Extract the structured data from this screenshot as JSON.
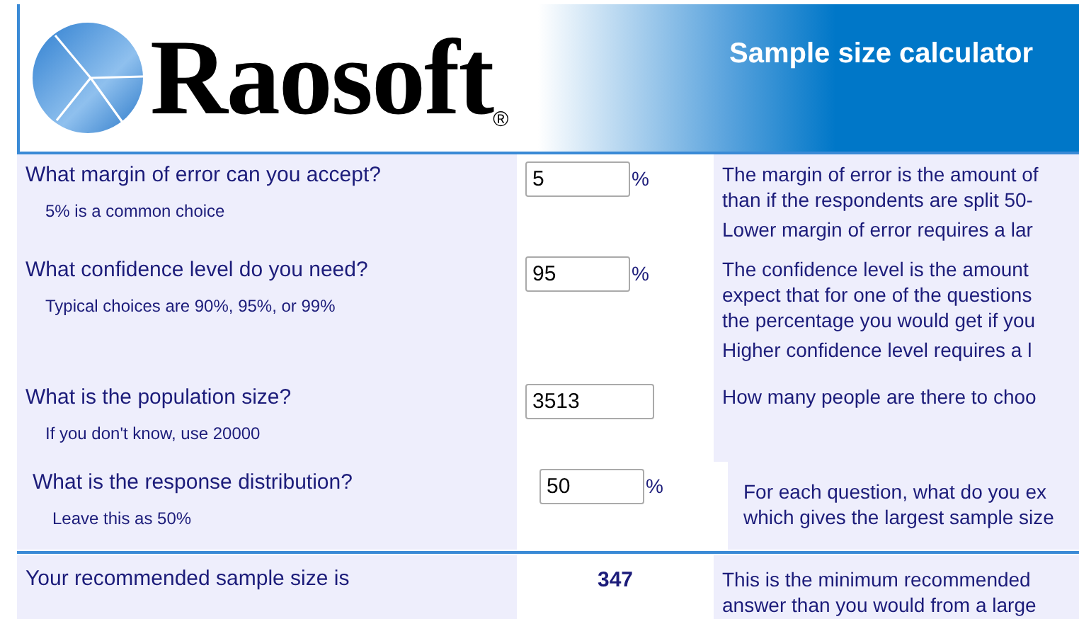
{
  "header": {
    "logo": "Raosoft",
    "registered_mark": "®",
    "title": "Sample size calculator"
  },
  "questions": [
    {
      "question": "What margin of error can you accept?",
      "hint": "5% is a common choice",
      "value": "5",
      "unit": "%",
      "explanation": [
        [
          "The margin of error is the amount of",
          "than if the respondents are split 50-"
        ],
        [
          "Lower margin of error requires a lar"
        ]
      ]
    },
    {
      "question": "What confidence level do you need?",
      "hint": "Typical choices are 90%, 95%, or 99%",
      "value": "95",
      "unit": "%",
      "explanation": [
        [
          "The confidence level is the amount",
          "expect that for one of the questions",
          "the percentage you would get if you"
        ],
        [
          "Higher confidence level requires a l"
        ]
      ]
    },
    {
      "question": "What is the population size?",
      "hint": "If you don't know, use 20000",
      "value": "3513",
      "explanation": [
        [
          "How many people are there to choo"
        ]
      ]
    },
    {
      "question": "What is the response distribution?",
      "hint": "Leave this as 50%",
      "value": "50",
      "unit": "%",
      "explanation": [
        [
          "For each question, what do you ex",
          "which gives the largest sample size"
        ]
      ]
    }
  ],
  "result": {
    "label": "Your recommended sample size is",
    "value": "347",
    "explanation": [
      [
        "This is the minimum recommended",
        "answer than you would from a large"
      ]
    ]
  }
}
